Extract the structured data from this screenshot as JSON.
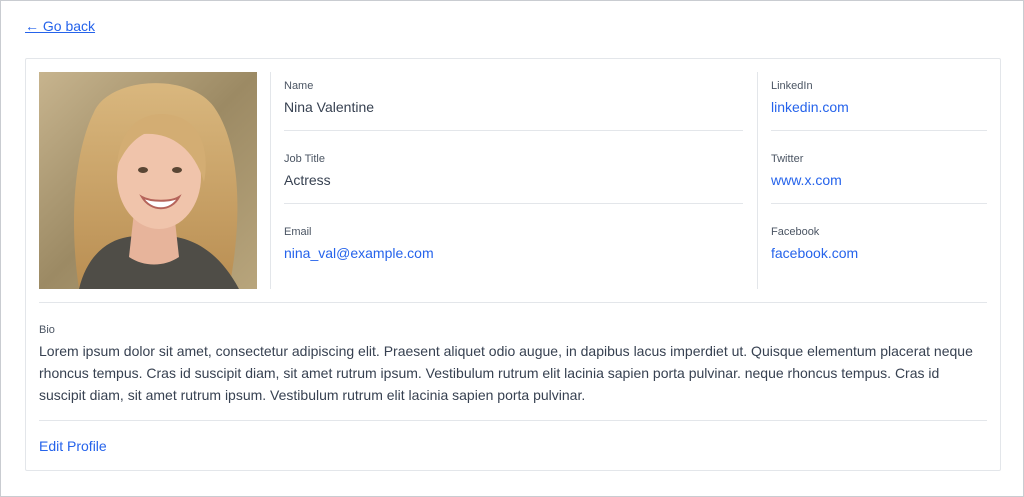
{
  "nav": {
    "back_label": "← Go back"
  },
  "profile": {
    "photo_alt": "Profile photo of a smiling woman with long blonde hair",
    "fields": [
      {
        "label": "Name",
        "value": "Nina Valentine"
      },
      {
        "label": "Job Title",
        "value": "Actress"
      },
      {
        "label": "Email",
        "value": "nina_val@example.com"
      }
    ],
    "social": [
      {
        "label": "LinkedIn",
        "value": "linkedin.com"
      },
      {
        "label": "Twitter",
        "value": "www.x.com"
      },
      {
        "label": "Facebook",
        "value": "facebook.com"
      }
    ],
    "bio_label": "Bio",
    "bio": "Lorem ipsum dolor sit amet, consectetur adipiscing elit. Praesent aliquet odio augue, in dapibus lacus imperdiet ut. Quisque elementum placerat neque rhoncus tempus. Cras id suscipit diam, sit amet rutrum ipsum. Vestibulum rutrum elit lacinia sapien porta pulvinar. neque rhoncus tempus. Cras id suscipit diam, sit amet rutrum ipsum. Vestibulum rutrum elit lacinia sapien porta pulvinar.",
    "edit_label": "Edit Profile"
  },
  "colors": {
    "accent": "#2563eb",
    "text": "#374151",
    "muted": "#4b5563",
    "border": "#e3e6ea"
  }
}
